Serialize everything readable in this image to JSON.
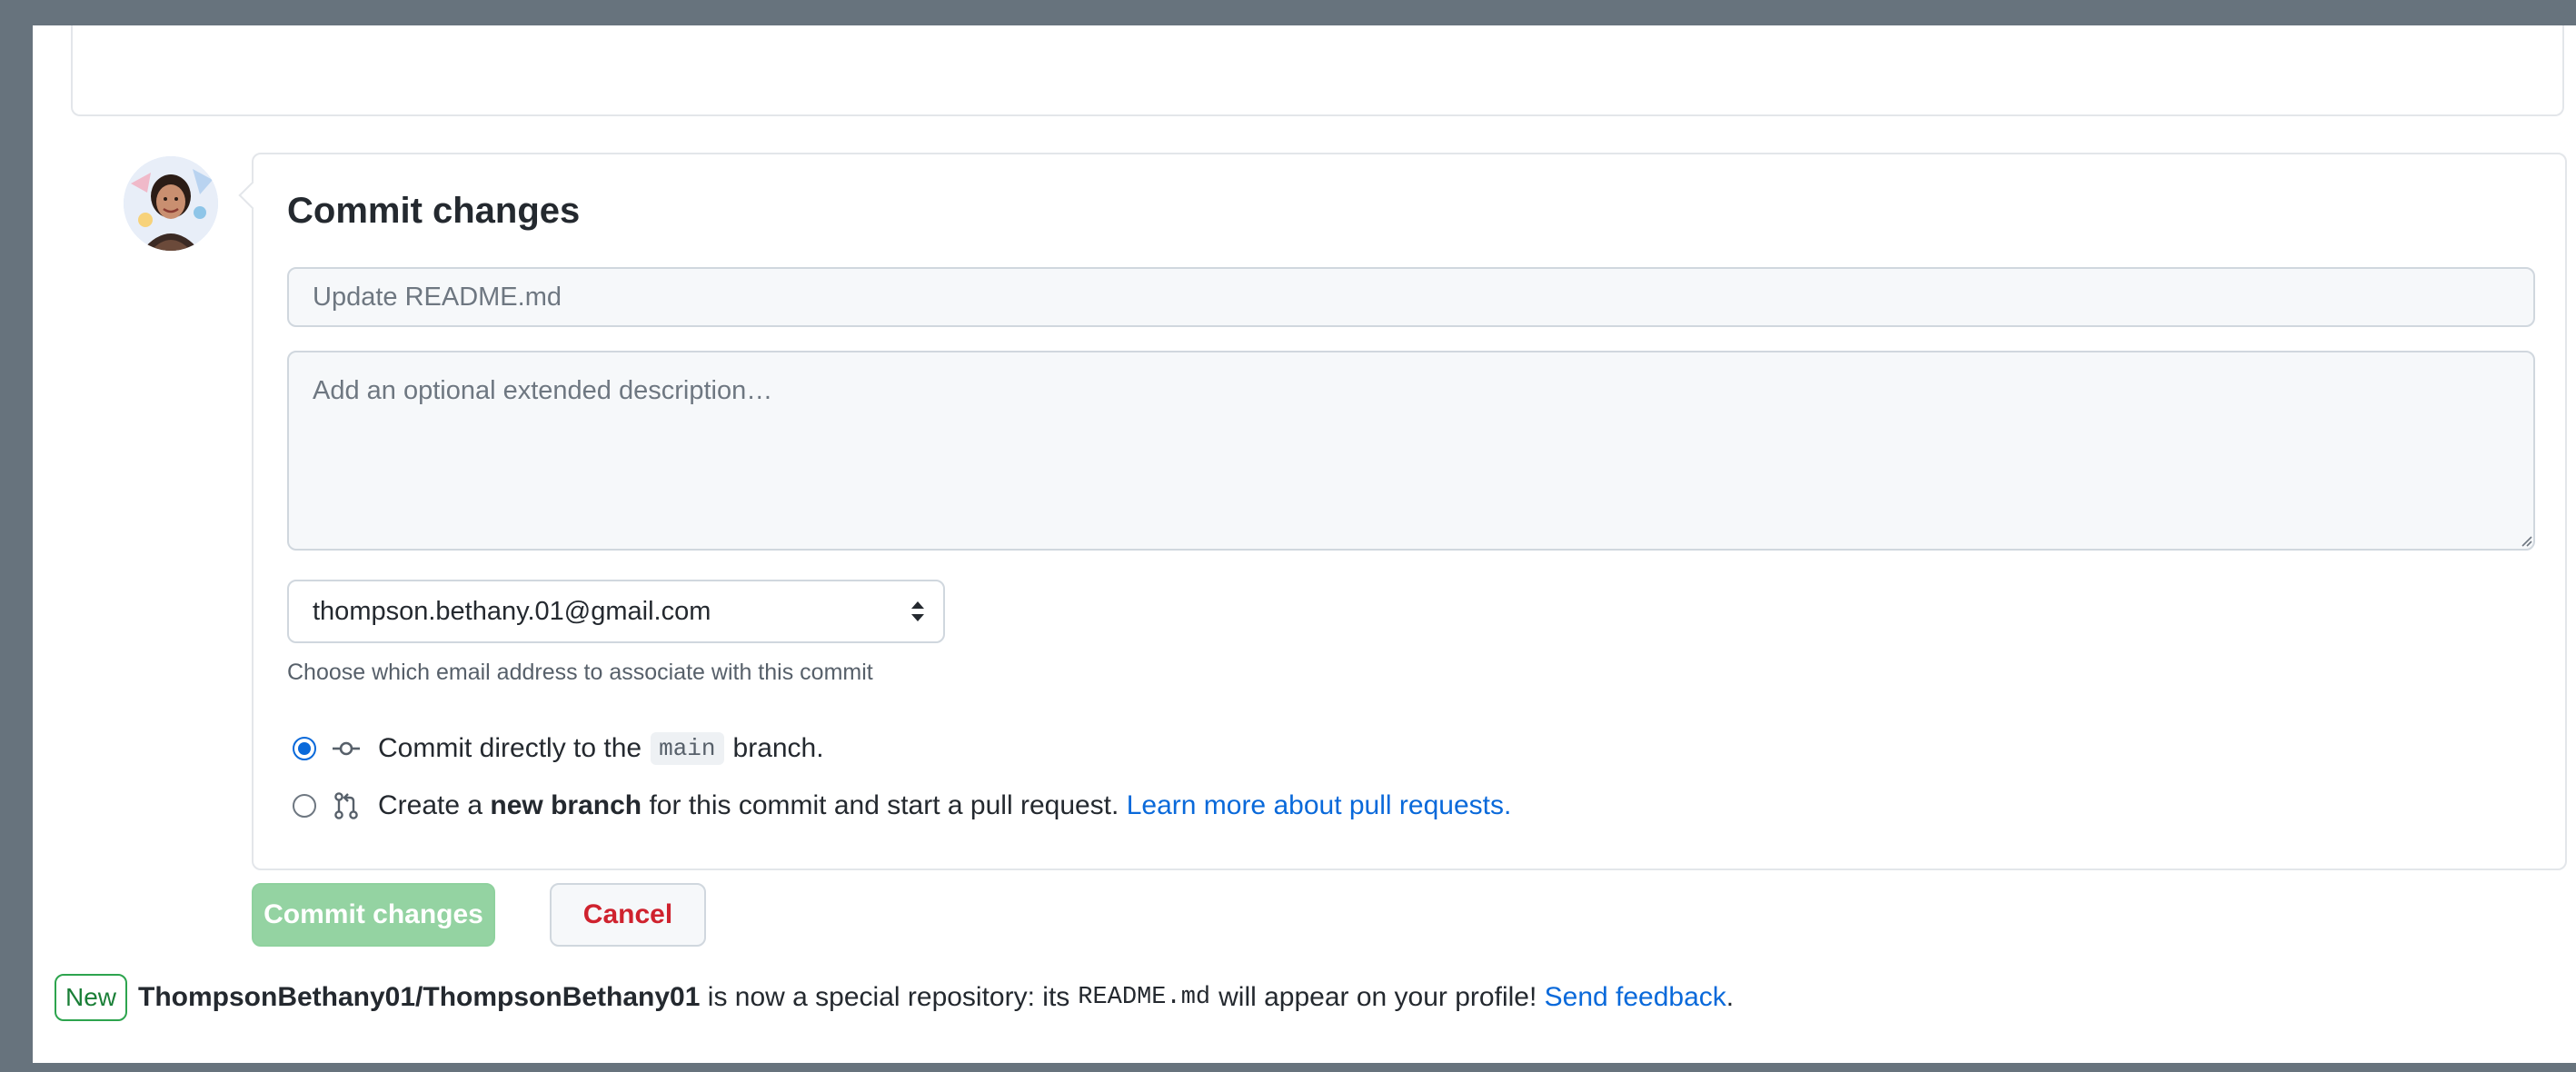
{
  "commit_form": {
    "title": "Commit changes",
    "summary_placeholder": "Update README.md",
    "summary_value": "",
    "description_placeholder": "Add an optional extended description…",
    "description_value": "",
    "email_selected": "thompson.bethany.01@gmail.com",
    "email_help": "Choose which email address to associate with this commit",
    "option_direct": {
      "prefix": "Commit directly to the",
      "branch": "main",
      "suffix": "branch.",
      "checked": true
    },
    "option_new_branch": {
      "prefix": "Create a",
      "bold": "new branch",
      "suffix": "for this commit and start a pull request.",
      "link": "Learn more about pull requests.",
      "checked": false
    }
  },
  "buttons": {
    "commit_label": "Commit changes",
    "cancel_label": "Cancel"
  },
  "notice": {
    "badge": "New",
    "repo": "ThompsonBethany01/ThompsonBethany01",
    "text1": "is now a special repository: its",
    "file": "README.md",
    "text2": "will appear on your profile!",
    "link": "Send feedback",
    "end": "."
  },
  "icons": {
    "avatar": "user-avatar",
    "commit": "git-commit-icon",
    "pull_request": "git-pull-request-icon",
    "select_arrows": "select-arrows-icon",
    "resize": "resize-grip-icon"
  },
  "colors": {
    "primary_button": "#94d3a2",
    "cancel_text": "#cf222e",
    "link": "#0969da",
    "badge_border": "#2da44e",
    "radio_checked": "#0969da"
  }
}
